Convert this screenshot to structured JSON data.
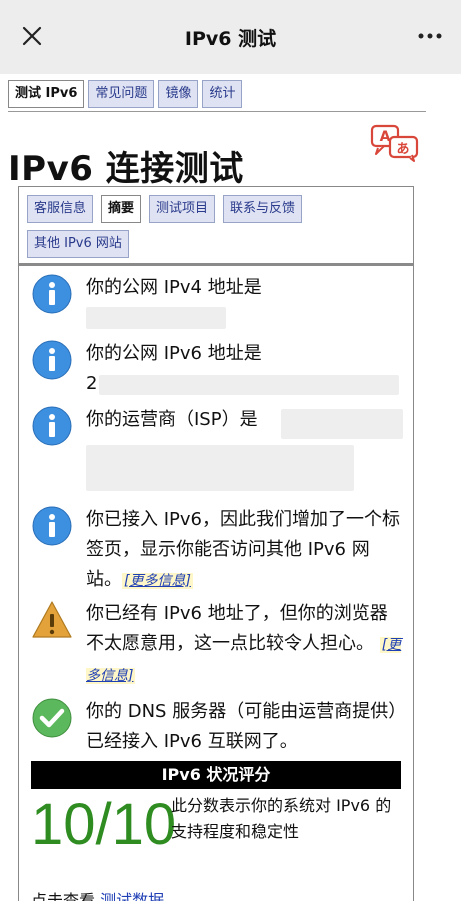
{
  "header": {
    "title": "IPv6 测试"
  },
  "page_tabs": [
    {
      "label": "测试 IPv6"
    },
    {
      "label": "常见问题"
    },
    {
      "label": "镜像"
    },
    {
      "label": "统计"
    }
  ],
  "page_title": "IPv6 连接测试",
  "inner_tabs": [
    {
      "label": "客服信息"
    },
    {
      "label": "摘要"
    },
    {
      "label": "测试项目"
    },
    {
      "label": "联系与反馈"
    },
    {
      "label": "其他 IPv6 网站"
    }
  ],
  "messages": {
    "ipv4": {
      "text": "你的公网 IPv4 地址是",
      "icon": "info-icon"
    },
    "ipv6": {
      "text": "你的公网 IPv6 地址是",
      "prefix": "2",
      "icon": "info-icon"
    },
    "isp": {
      "text": "你的运营商（ISP）是",
      "icon": "info-icon"
    },
    "tab_added": {
      "text": "你已接入 IPv6，因此我们增加了一个标签页，显示你能否访问其他 IPv6 网站。",
      "link": "[更多信息]",
      "icon": "info-icon"
    },
    "warning": {
      "text": "你已经有 IPv6 地址了，但你的浏览器不太愿意用，这一点比较令人担心。",
      "link": "[更多信息]",
      "icon": "warning-icon"
    },
    "dns": {
      "text": "你的 DNS 服务器（可能由运营商提供）已经接入 IPv6 互联网了。",
      "icon": "check-icon"
    }
  },
  "score": {
    "heading": "IPv6 状况评分",
    "value": "10/10",
    "description": "此分数表示你的系统对 IPv6 的支持程度和稳定性"
  },
  "footer": {
    "prefix": "点击查看",
    "link": "测试数据"
  },
  "colors": {
    "info": "#3d8fe0",
    "warning": "#e3a33a",
    "check": "#5cb85c",
    "score": "#2f8c21",
    "link": "#1f3fb5"
  }
}
